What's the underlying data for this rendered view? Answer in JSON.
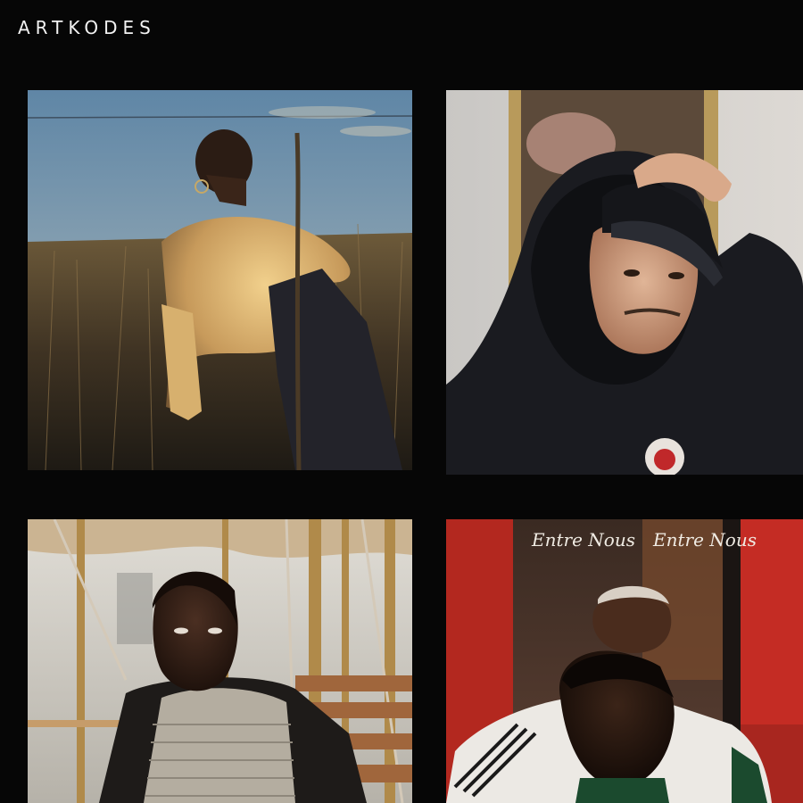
{
  "header": {
    "brand": "ARTKODES"
  },
  "gallery": {
    "photos": [
      {
        "subject": "woman in field at sunset",
        "dominant_color": "#5a4a30"
      },
      {
        "subject": "man in black hoodie and cap",
        "dominant_color": "#1c1e24"
      },
      {
        "subject": "man on carousel bench",
        "dominant_color": "#b9b7b0"
      },
      {
        "subject": "two men at red storefront",
        "dominant_color": "#a8261f"
      }
    ],
    "storefront_signs": [
      "Entre Nous",
      "Entre Nous"
    ]
  },
  "theme": {
    "background": "#060606",
    "text": "#f2f2f2"
  }
}
